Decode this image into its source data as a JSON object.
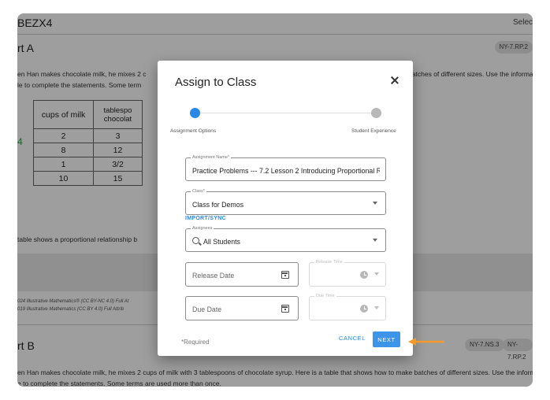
{
  "background": {
    "title": "BEZX4",
    "select_label": "Selec",
    "part_a_label": "rt A",
    "part_a_standard": "NY-7.RP.2",
    "problem_line1_left": "en Han makes chocolate milk, he mixes 2 c",
    "problem_line1_right": "ake batches of different sizes. Use the informa",
    "problem_line2": "le to complete the statements. Some term",
    "table": {
      "headers": [
        "cups of milk",
        "tablespo chocolat"
      ],
      "rows": [
        [
          "2",
          "3"
        ],
        [
          "8",
          "12"
        ],
        [
          "1",
          "3/2"
        ],
        [
          "10",
          "15"
        ]
      ]
    },
    "annotation": "4",
    "statement_line": "table shows a proportional relationship b",
    "citation_line1": "024 Illustrative Mathematics® (CC BY-NC 4.0)  Full At",
    "citation_line2": "019 Illustrative Mathematics (CC BY 4.0)  Full Attrib",
    "part_b_label": "rt B",
    "part_b_standards": [
      "NY-7.NS.3",
      "NY-7.RP.2"
    ],
    "problem_b_line1": "en Han makes chocolate milk, he mixes 2 cups of milk with 3 tablespoons of chocolate syrup. Here is a table that shows how to make batches of different sizes. Use the informa",
    "problem_b_line2": "e to complete the statements. Some terms are used more than once."
  },
  "modal": {
    "title": "Assign to Class",
    "steps": [
      {
        "label": "Assignment Options"
      },
      {
        "label": "Student Experience"
      }
    ],
    "assignment_name": {
      "legend": "Assignment Name*",
      "value": "Practice Problems --- 7.2 Lesson 2 Introducing Proportional Re"
    },
    "class_field": {
      "legend": "Class*",
      "value": "Class for Demos"
    },
    "import_sync_label": "IMPORT/SYNC",
    "assignees": {
      "legend": "Assignees",
      "value": "All Students"
    },
    "release_date": {
      "placeholder": "Release Date"
    },
    "release_time": {
      "legend": "Release Time"
    },
    "due_date": {
      "placeholder": "Due Date"
    },
    "due_time": {
      "legend": "Due Time"
    },
    "required_note": "*Required",
    "cancel_label": "CANCEL",
    "next_label": "NEXT"
  },
  "colors": {
    "accent": "#2b87e6",
    "next_button": "#3d95ea",
    "highlight_arrow": "#f39a2b"
  },
  "icons": [
    "close-icon",
    "search-icon",
    "calendar-icon",
    "clock-icon",
    "chevron-down-icon",
    "arrow-left-icon"
  ]
}
